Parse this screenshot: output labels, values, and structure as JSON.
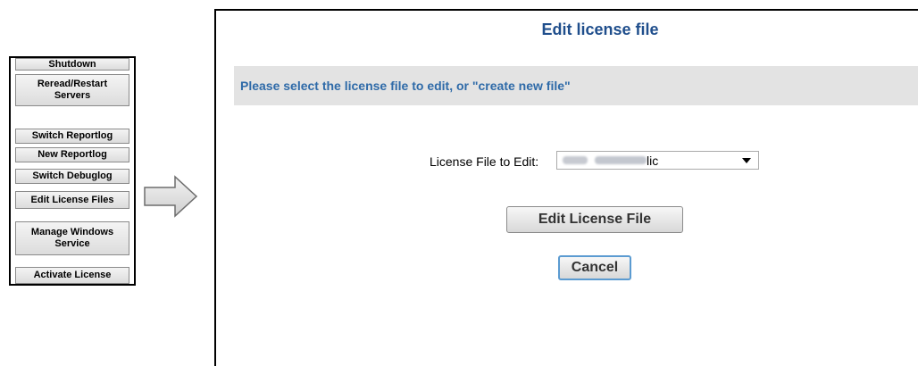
{
  "menu": {
    "items": [
      {
        "label": "Shutdown"
      },
      {
        "label": "Reread/Restart Servers"
      },
      {
        "label": "Switch Reportlog"
      },
      {
        "label": "New Reportlog"
      },
      {
        "label": "Switch Debuglog"
      },
      {
        "label": "Edit License Files"
      },
      {
        "label": "Manage Windows Service"
      },
      {
        "label": "Activate License"
      }
    ]
  },
  "arrow_icon": "right-arrow-icon",
  "dialog": {
    "title": "Edit license file",
    "instruction": "Please select the license file to edit, or \"create new file\"",
    "field_label": "License File to Edit:",
    "selected_file_suffix": "lic",
    "edit_button": "Edit License File",
    "cancel_button": "Cancel"
  }
}
